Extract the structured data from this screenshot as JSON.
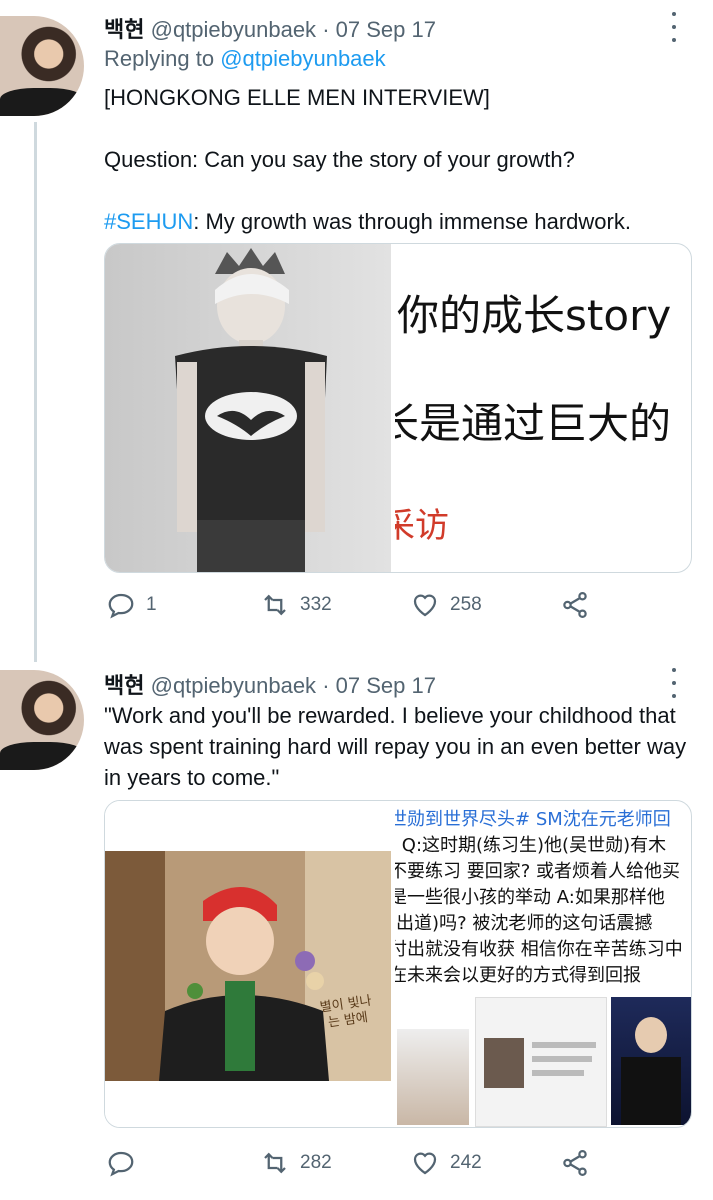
{
  "tweets": [
    {
      "display_name": "백현",
      "handle": "@qtpiebyunbaek",
      "separator": "·",
      "date": "07 Sep 17",
      "replying_prefix": "Replying to",
      "replying_handle": "@qtpiebyunbaek",
      "line1": "[HONGKONG ELLE MEN INTERVIEW]",
      "question": "Question: Can you say the story of your growth?",
      "hashtag": "#SEHUN",
      "answer": ": My growth was through immense hardwork.",
      "image_right_lines": [
        "你的成长story",
        "长是通过巨大的",
        "采访"
      ],
      "actions": {
        "replies": "1",
        "retweets": "332",
        "likes": "258"
      }
    },
    {
      "display_name": "백현",
      "handle": "@qtpiebyunbaek",
      "separator": "·",
      "date": "07 Sep 17",
      "body": "\"Work and you'll be rewarded. I believe your childhood that was spent training hard will repay you in an even better way in years to come.\"",
      "image_right_lines": [
        "世勋到世界尽头# SM沈在元老师回",
        "] Q:这时期(练习生)他(吴世勋)有木",
        "不要练习 要回家? 或者烦着人给他买",
        "是一些很小孩的举动 A:如果那样他",
        "(出道)吗? 被沈老师的这句话震撼",
        "付出就没有收获 相信你在辛苦练习中",
        "在未来会以更好的方式得到回报"
      ],
      "sticker_text": "별이 빛나는 밤에",
      "actions": {
        "replies": "",
        "retweets": "282",
        "likes": "242"
      }
    }
  ],
  "colors": {
    "link": "#1d9bf0",
    "muted": "#536471",
    "text": "#0f1419",
    "line": "#cfd9de"
  }
}
